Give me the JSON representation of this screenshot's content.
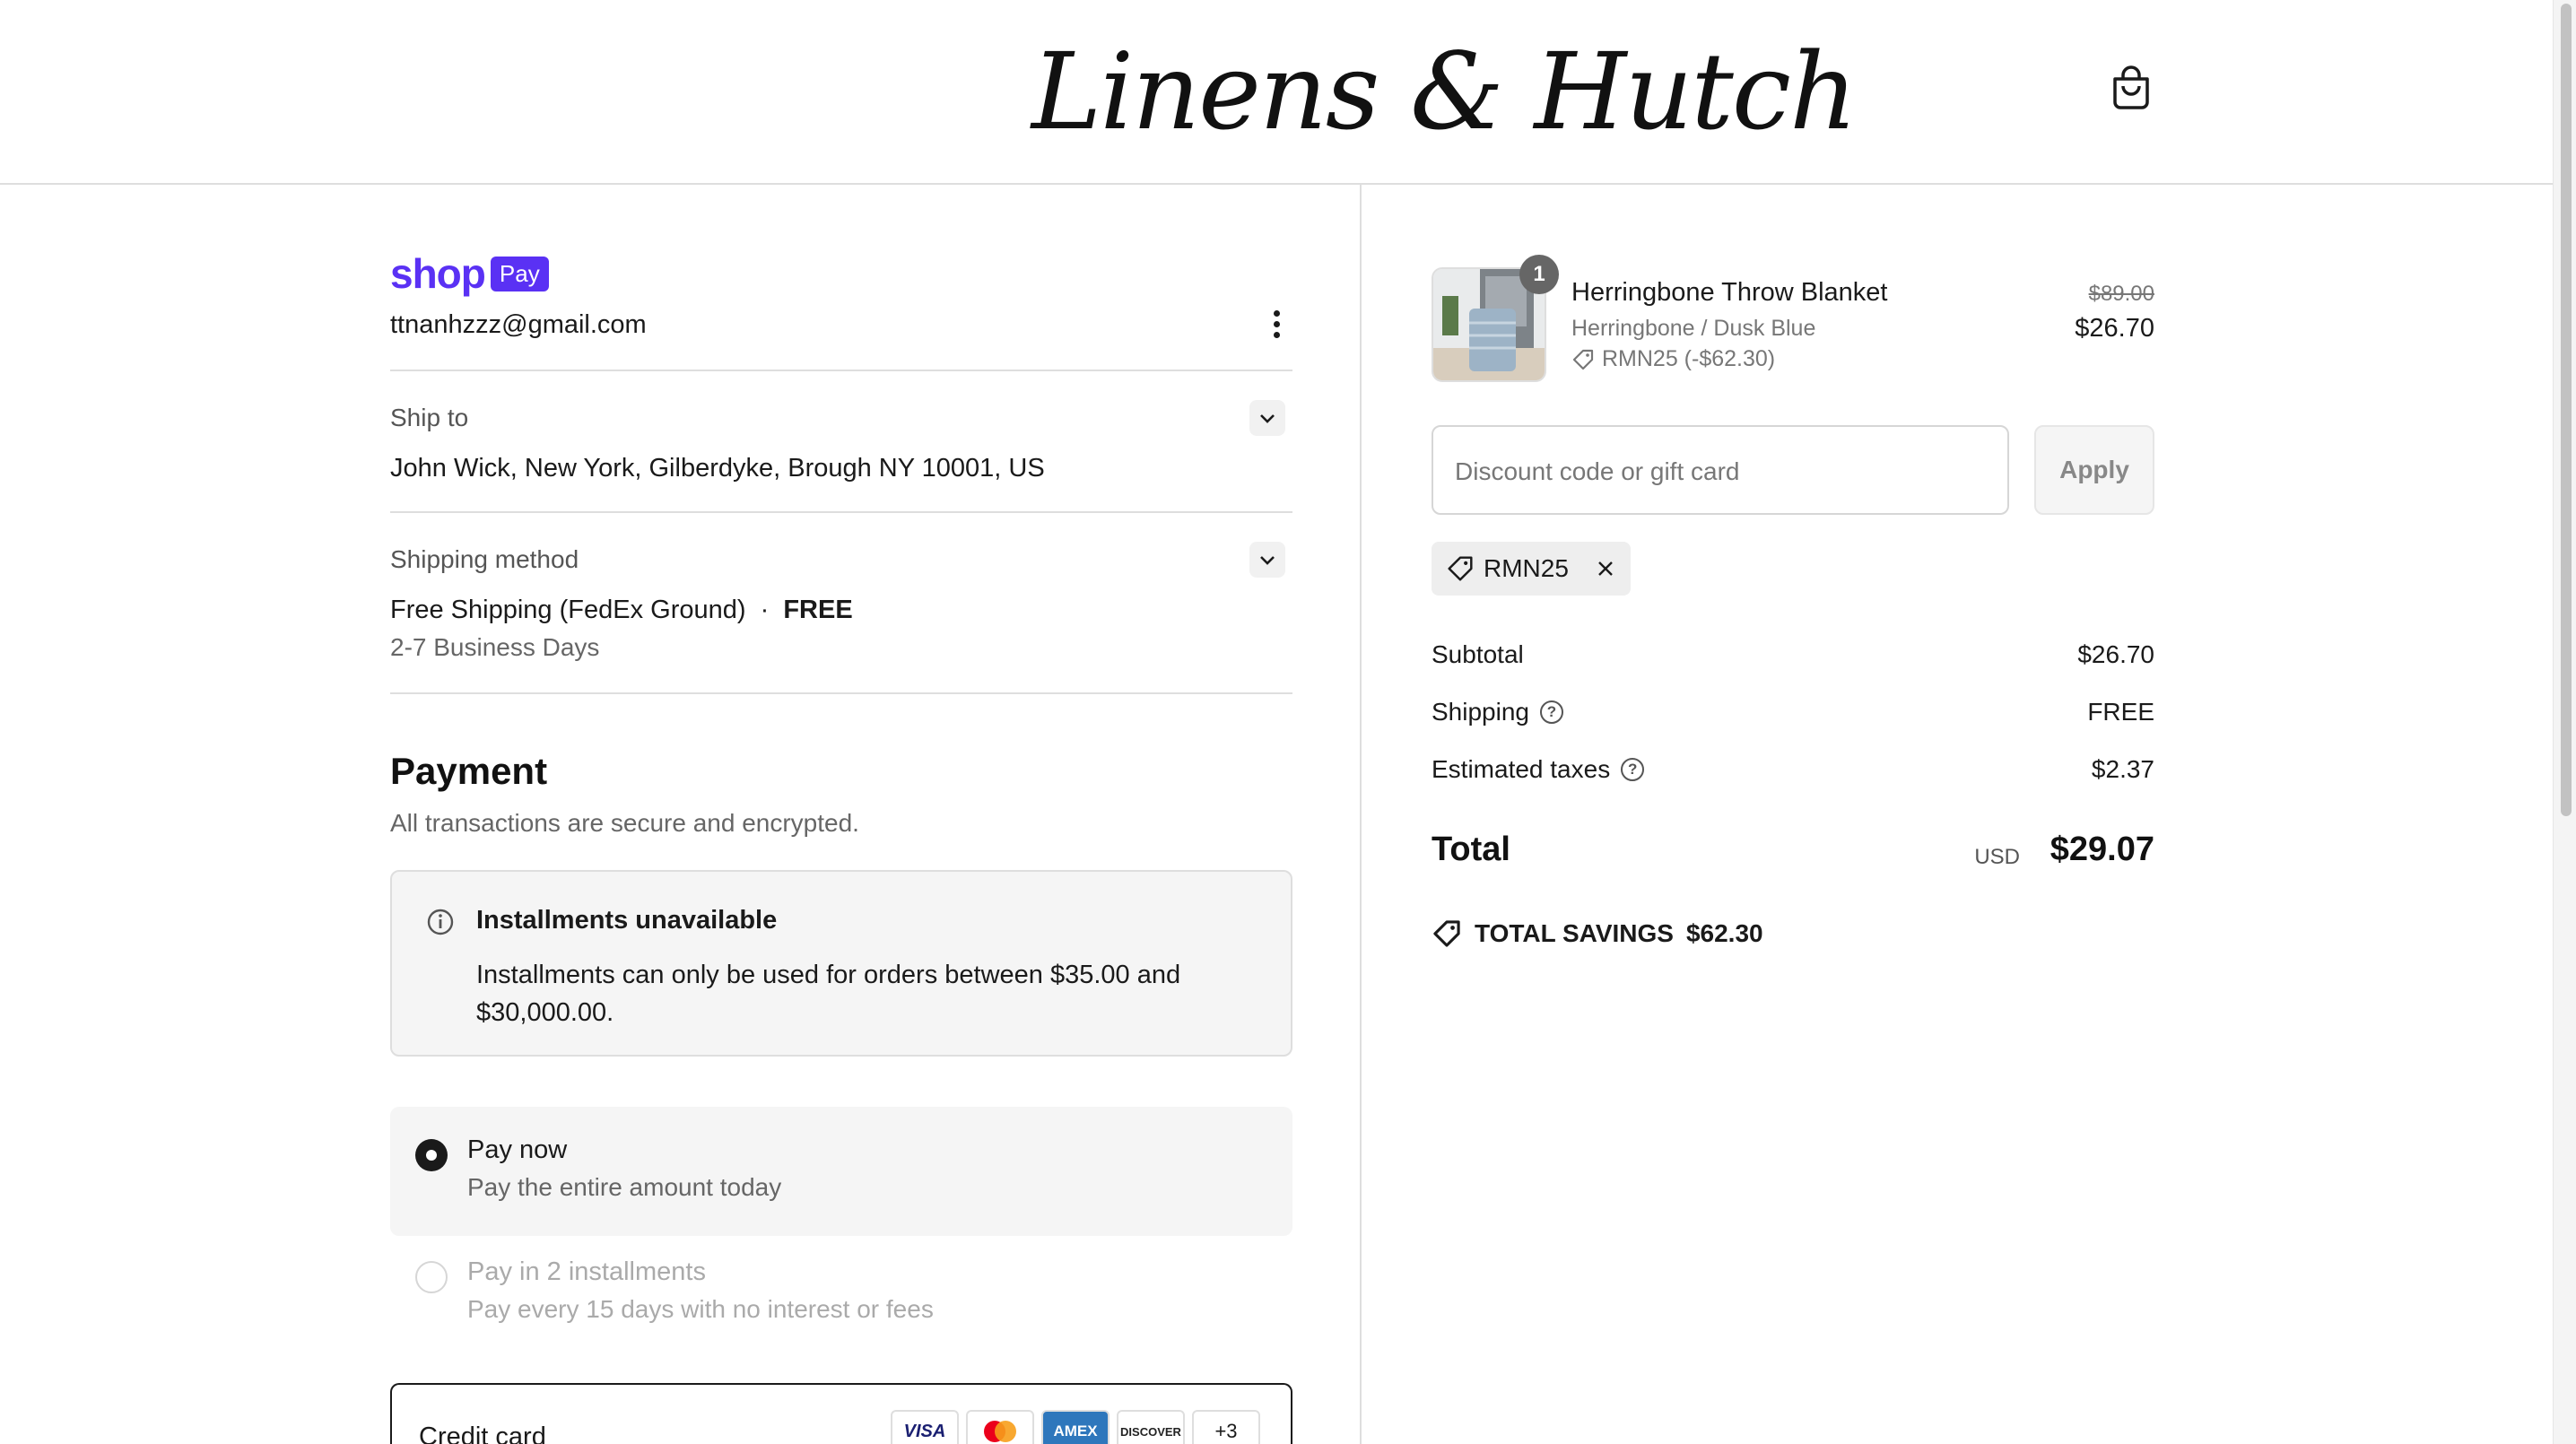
{
  "header": {
    "brand": "Linens & Hutch",
    "cart_icon": "shopping-bag-icon"
  },
  "account": {
    "wallet_brand": "shop",
    "wallet_badge": "Pay",
    "email": "ttnanhzzz@gmail.com",
    "menu_icon": "more-vertical-icon"
  },
  "ship_to": {
    "label": "Ship to",
    "address": "John Wick, New York, Gilberdyke, Brough NY 10001, US"
  },
  "shipping_method": {
    "label": "Shipping method",
    "name": "Free Shipping (FedEx Ground)",
    "separator": "·",
    "price": "FREE",
    "eta": "2-7 Business Days"
  },
  "payment": {
    "title": "Payment",
    "subtitle": "All transactions are secure and encrypted.",
    "notice": {
      "title": "Installments unavailable",
      "body": "Installments can only be used for orders between $35.00 and $30,000.00."
    },
    "options": [
      {
        "title": "Pay now",
        "subtitle": "Pay the entire amount today",
        "selected": true,
        "enabled": true
      },
      {
        "title": "Pay in 2 installments",
        "subtitle": "Pay every 15 days with no interest or fees",
        "selected": false,
        "enabled": false
      }
    ],
    "credit_card": {
      "label": "Credit card",
      "brands": [
        "VISA",
        "",
        "AMEX",
        "DISCOVER",
        "+3"
      ]
    }
  },
  "order": {
    "item": {
      "quantity": "1",
      "name": "Herringbone Throw Blanket",
      "variant": "Herringbone / Dusk Blue",
      "discount": "RMN25 (-$62.30)",
      "original_price": "$89.00",
      "price": "$26.70"
    },
    "discount_input": {
      "placeholder": "Discount code or gift card",
      "button": "Apply"
    },
    "applied_code": "RMN25",
    "subtotal": {
      "label": "Subtotal",
      "value": "$26.70"
    },
    "shipping": {
      "label": "Shipping",
      "value": "FREE"
    },
    "taxes": {
      "label": "Estimated taxes",
      "value": "$2.37"
    },
    "total": {
      "label": "Total",
      "currency": "USD",
      "value": "$29.07"
    },
    "savings": {
      "label": "TOTAL SAVINGS",
      "value": "$62.30"
    }
  },
  "colors": {
    "shop_pay_purple": "#5a31f4",
    "divider": "#dedede",
    "muted_text": "#666666"
  }
}
